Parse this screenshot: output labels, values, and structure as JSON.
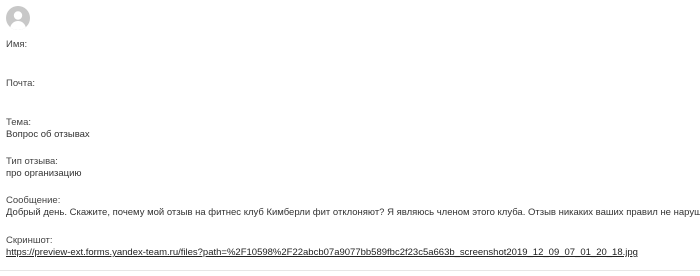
{
  "fields": {
    "name_label": "Имя:",
    "name_value": "",
    "email_label": "Почта:",
    "email_value": "",
    "subject_label": "Тема:",
    "subject_value": "Вопрос об отзывах",
    "review_type_label": "Тип отзыва:",
    "review_type_value": "про организацию",
    "message_label": "Сообщение:",
    "message_value": "Добрый день. Скажите, почему мой отзыв на фитнес клуб Кимберли фит отклоняют? Я являюсь членом этого клуба. Отзыв никаких ваших правил не нарушает.",
    "screenshot_label": "Скриншот:",
    "screenshot_link": "https://preview-ext.forms.yandex-team.ru/files?path=%2F10598%2F22abcb07a9077bb589fbc2f23c5a663b_screenshot2019_12_09_07_01_20_18.jpg"
  }
}
